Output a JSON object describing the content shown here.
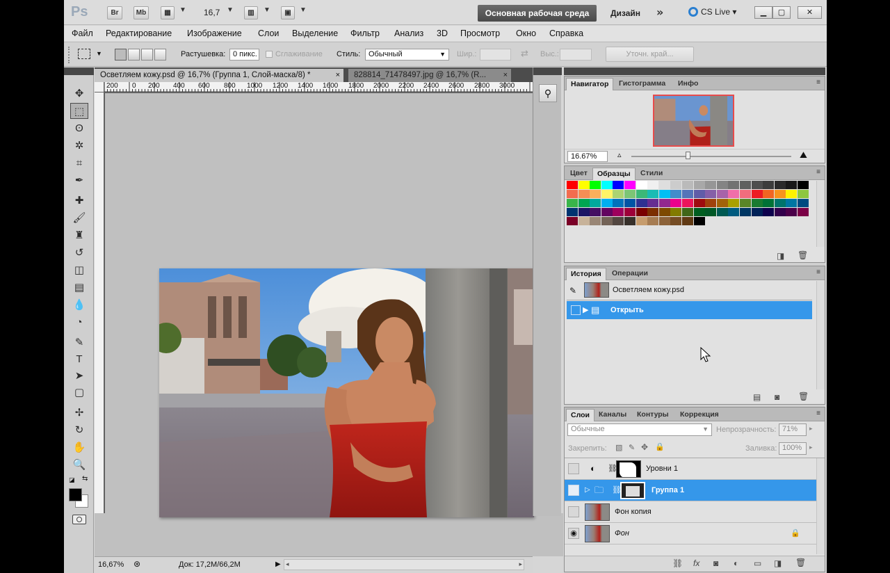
{
  "appbar": {
    "logo": "Ps",
    "bridge": "Br",
    "minibridge": "Mb",
    "zoom": "16,7",
    "workspace_active": "Основная рабочая среда",
    "workspace_design": "Дизайн",
    "workspace_more": "»",
    "cslive": "CS Live"
  },
  "menu": [
    "Файл",
    "Редактирование",
    "Изображение",
    "Слои",
    "Выделение",
    "Фильтр",
    "Анализ",
    "3D",
    "Просмотр",
    "Окно",
    "Справка"
  ],
  "options": {
    "feather_label": "Растушевка:",
    "feather_value": "0 пикс.",
    "antialias_label": "Сглаживание",
    "style_label": "Стиль:",
    "style_value": "Обычный",
    "width_label": "Шир.:",
    "height_label": "Выс.:",
    "refine_edge": "Уточн. край..."
  },
  "tabs": [
    {
      "label": "Осветляем кожу.psd @ 16,7% (Группа 1, Слой-маска/8) *",
      "close": "×"
    },
    {
      "label": "828814_71478497.jpg @ 16,7% (R...",
      "close": "×"
    }
  ],
  "ruler": [
    "200",
    "0",
    "200",
    "400",
    "600",
    "800",
    "1000",
    "1200",
    "1400",
    "1600",
    "1800",
    "2000",
    "2200",
    "2400",
    "2600",
    "2800",
    "3000"
  ],
  "status": {
    "zoom": "16,67%",
    "doc": "Док: 17,2M/66,2M"
  },
  "navigator": {
    "tabs": [
      "Навигатор",
      "Гистограмма",
      "Инфо"
    ],
    "zoom": "16.67%"
  },
  "swatches_panel": {
    "tabs": [
      "Цвет",
      "Образцы",
      "Стили"
    ],
    "rows": [
      [
        "#ff0000",
        "#ffff00",
        "#00ff00",
        "#00ffff",
        "#0000ff",
        "#ff00ff",
        "#ffffff",
        "#f0f0f0",
        "#dedede",
        "#cccccc",
        "#bababa",
        "#a8a8a8",
        "#969696",
        "#848484",
        "#727272",
        "#606060",
        "#4e4e4e",
        "#3c3c3c",
        "#2a2a2a",
        "#181818",
        "#000000"
      ],
      [
        "#f26c4f",
        "#f68e55",
        "#fbaf5c",
        "#fff467",
        "#acd372",
        "#7cc576",
        "#3bb878",
        "#1abbb4",
        "#00bff3",
        "#438ccb",
        "#5574b9",
        "#605ca8",
        "#855fa8",
        "#a763a9",
        "#f06ea9",
        "#f26d7d",
        "#ed1c24",
        "#f26522",
        "#f7941d",
        "#fff200",
        "#8dc63f"
      ],
      [
        "#39b54a",
        "#00a651",
        "#00a99d",
        "#00aeef",
        "#0072bc",
        "#0054a5",
        "#2e3192",
        "#662d91",
        "#92278f",
        "#ec008c",
        "#ed145b",
        "#9e0b0f",
        "#a0410d",
        "#a36209",
        "#aba000",
        "#598527",
        "#197b30",
        "#007236",
        "#00746b",
        "#0076a3",
        "#004a80"
      ],
      [
        "#003471",
        "#1b1464",
        "#440e62",
        "#630460",
        "#9e005d",
        "#9e0039",
        "#790000",
        "#7b2e00",
        "#7d4900",
        "#827b00",
        "#406618",
        "#005e20",
        "#005826",
        "#005952",
        "#005b7f",
        "#003663",
        "#002157",
        "#0d004c",
        "#32004b",
        "#4b0049",
        "#7b0046"
      ],
      [
        "#7a0026",
        "#c7b299",
        "#998675",
        "#736357",
        "#534741",
        "#37302a",
        "#c69c6d",
        "#a67c52",
        "#8c6239",
        "#754c24",
        "#603913",
        "#000000"
      ]
    ]
  },
  "history": {
    "tabs": [
      "История",
      "Операции"
    ],
    "snapshot": "Осветляем кожу.psd",
    "items": [
      "Открыть"
    ]
  },
  "layers": {
    "tabs": [
      "Слои",
      "Каналы",
      "Контуры",
      "Коррекция"
    ],
    "blend_mode": "Обычные",
    "opacity_label": "Непрозрачность:",
    "opacity_value": "71%",
    "lock_label": "Закрепить:",
    "fill_label": "Заливка:",
    "fill_value": "100%",
    "items": [
      {
        "name": "Уровни 1"
      },
      {
        "name": "Группа 1"
      },
      {
        "name": "Фон копия"
      },
      {
        "name": "Фон"
      }
    ]
  },
  "colors": {
    "accent": "#3597ea",
    "workspace_bg": "#555555",
    "fg_color": "#000000",
    "bg_color": "#ffffff"
  }
}
